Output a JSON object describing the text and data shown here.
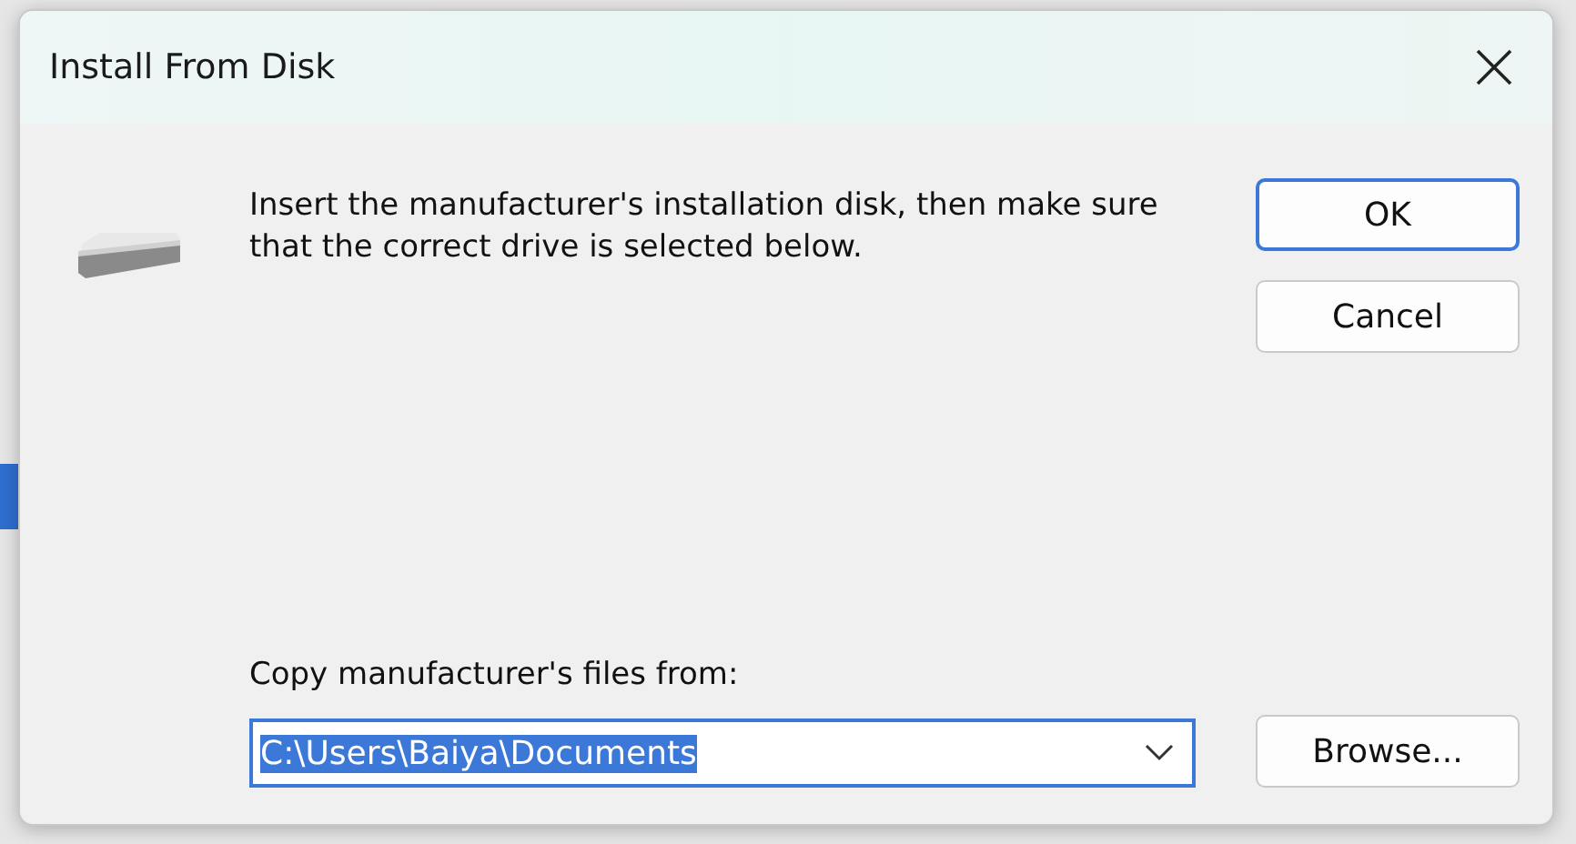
{
  "window": {
    "title": "Install From Disk"
  },
  "message": "Insert the manufacturer's installation disk, then make sure that the correct drive is selected below.",
  "buttons": [
    {
      "label": "OK",
      "default": true
    },
    {
      "label": "Cancel",
      "default": false
    }
  ],
  "copy_from": {
    "label": "Copy manufacturer's files from:",
    "value": "C:\\Users\\Baiya\\Documents",
    "text_selected": true
  },
  "browse_button": "Browse..."
}
